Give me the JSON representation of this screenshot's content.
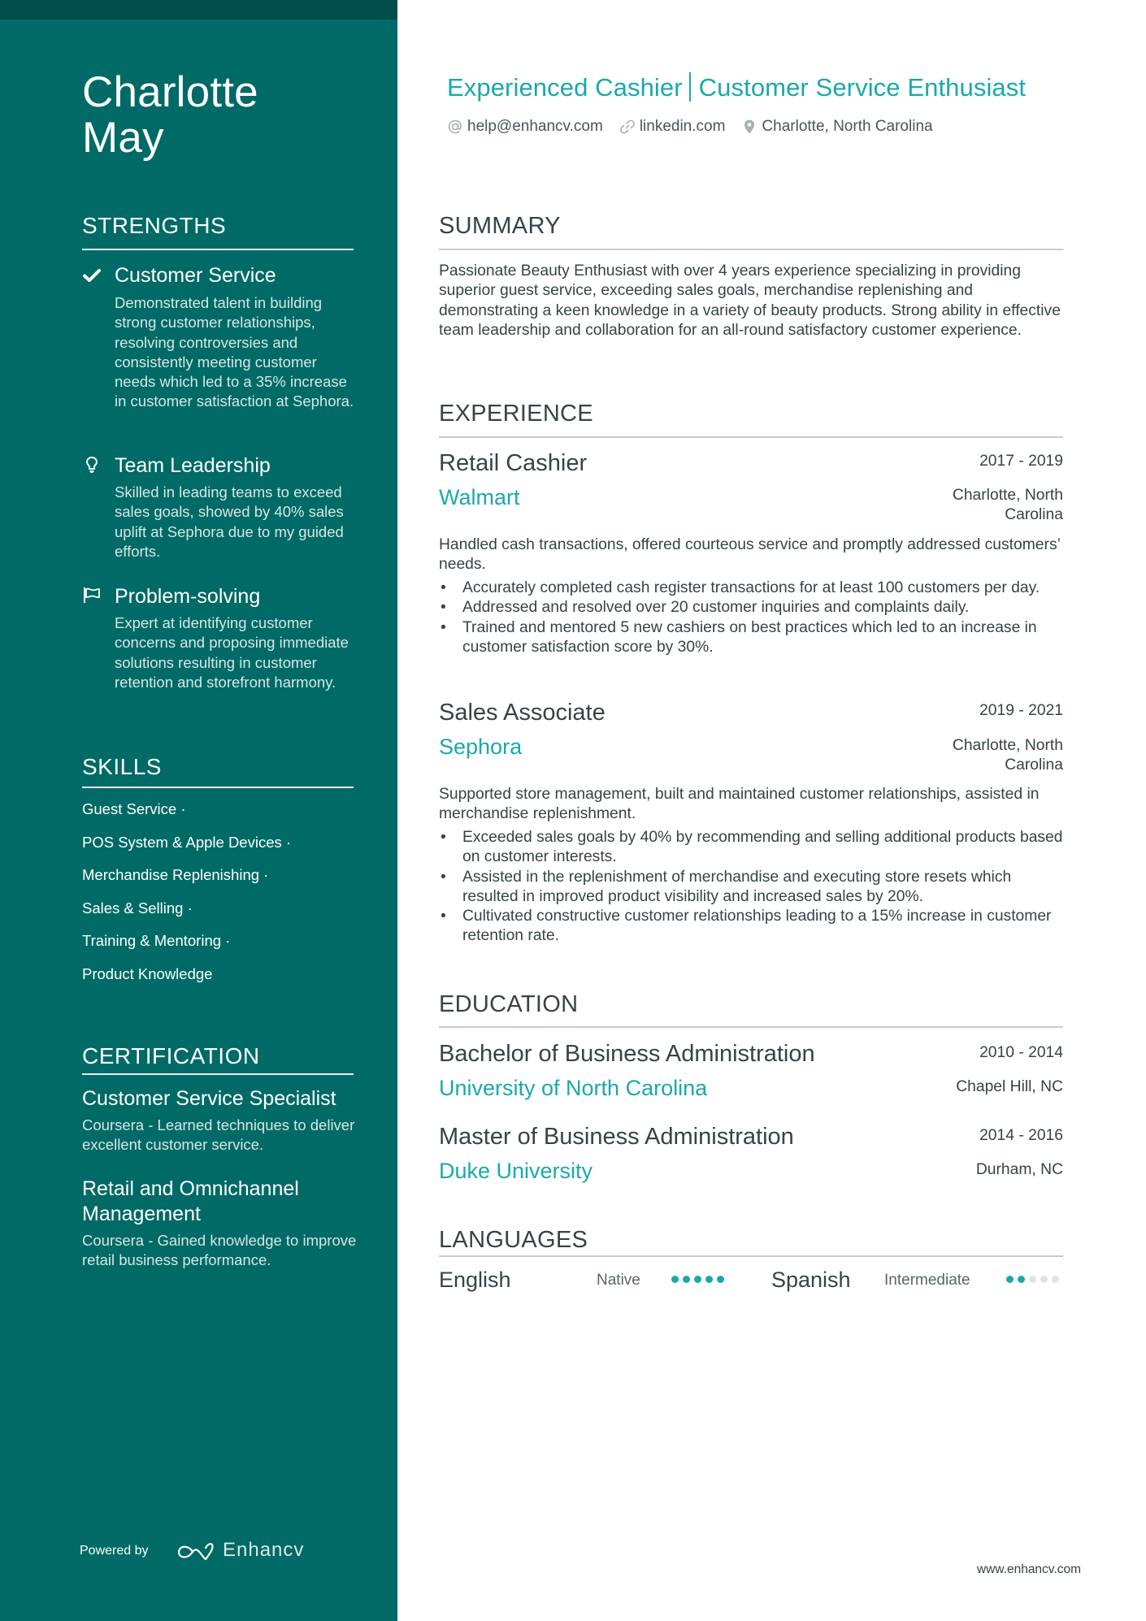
{
  "colors": {
    "sidebar": "#006a66",
    "sidebar_band": "#004d4a",
    "accent": "#1aa9ab",
    "text": "#384347"
  },
  "name": "Charlotte May",
  "name_lines": [
    "Charlotte",
    "May"
  ],
  "headline": {
    "part1": "Experienced Cashier",
    "part2": "Customer Service Enthusiast"
  },
  "contacts": [
    {
      "icon": "at-icon",
      "label": "help@enhancv.com"
    },
    {
      "icon": "link-icon",
      "label": "linkedin.com"
    },
    {
      "icon": "location-pin-icon",
      "label": "Charlotte, North Carolina"
    }
  ],
  "sidebar": {
    "strengths": {
      "heading": "STRENGTHS",
      "items": [
        {
          "icon": "check-icon",
          "title": "Customer Service",
          "description": "Demonstrated talent in building strong customer relationships, resolving controversies and consistently meeting customer needs which led to a 35% increase in customer satisfaction at Sephora."
        },
        {
          "icon": "lightbulb-icon",
          "title": "Team Leadership",
          "description": "Skilled in leading teams to exceed sales goals, showed by 40% sales uplift at Sephora due to my guided efforts."
        },
        {
          "icon": "flag-icon",
          "title": "Problem-solving",
          "description": "Expert at identifying customer concerns and proposing immediate solutions resulting in customer retention and storefront harmony."
        }
      ]
    },
    "skills": {
      "heading": "SKILLS",
      "items": [
        "Guest Service ·",
        "POS System & Apple Devices ·",
        "Merchandise Replenishing ·",
        "Sales & Selling ·",
        "Training & Mentoring ·",
        "Product Knowledge"
      ]
    },
    "certification": {
      "heading": "CERTIFICATION",
      "items": [
        {
          "title": "Customer Service Specialist",
          "description": "Coursera - Learned techniques to deliver excellent customer service."
        },
        {
          "title": "Retail and Omnichannel Management",
          "description": "Coursera - Gained knowledge to improve retail business performance."
        }
      ]
    },
    "powered_by": "Powered by",
    "brand": "Enhancv"
  },
  "summary": {
    "heading": "SUMMARY",
    "text": "Passionate Beauty Enthusiast with over 4 years experience specializing in providing superior guest service, exceeding sales goals, merchandise replenishing and demonstrating a keen knowledge in a variety of beauty products. Strong ability in effective team leadership and collaboration for an all-round satisfactory customer experience."
  },
  "experience": {
    "heading": "EXPERIENCE",
    "items": [
      {
        "role": "Retail Cashier",
        "company": "Walmart",
        "dates": "2017 - 2019",
        "location": "Charlotte, North Carolina",
        "description": "Handled cash transactions, offered courteous service and promptly addressed customers’ needs.",
        "bullets": [
          "Accurately completed cash register transactions for at least 100 customers per day.",
          "Addressed and resolved over 20 customer inquiries and complaints daily.",
          "Trained and mentored 5 new cashiers on best practices which led to an increase in customer satisfaction score by 30%."
        ]
      },
      {
        "role": "Sales Associate",
        "company": "Sephora",
        "dates": "2019 - 2021",
        "location": "Charlotte, North Carolina",
        "description": "Supported store management, built and maintained customer relationships, assisted in merchandise replenishment.",
        "bullets": [
          "Exceeded sales goals by 40% by recommending and selling additional products based on customer interests.",
          "Assisted in the replenishment of merchandise and executing store resets which resulted in improved product visibility and increased sales by 20%.",
          "Cultivated constructive customer relationships leading to a 15% increase in customer retention rate."
        ]
      }
    ]
  },
  "education": {
    "heading": "EDUCATION",
    "items": [
      {
        "degree": "Bachelor of Business Administration",
        "school": "University of North Carolina",
        "dates": "2010 - 2014",
        "location": "Chapel Hill, NC"
      },
      {
        "degree": "Master of Business Administration",
        "school": "Duke University",
        "dates": "2014 - 2016",
        "location": "Durham, NC"
      }
    ]
  },
  "languages": {
    "heading": "LANGUAGES",
    "items": [
      {
        "name": "English",
        "level": "Native",
        "rating": 5,
        "max": 5
      },
      {
        "name": "Spanish",
        "level": "Intermediate",
        "rating": 2,
        "max": 5
      }
    ]
  },
  "footer_url": "www.enhancv.com"
}
